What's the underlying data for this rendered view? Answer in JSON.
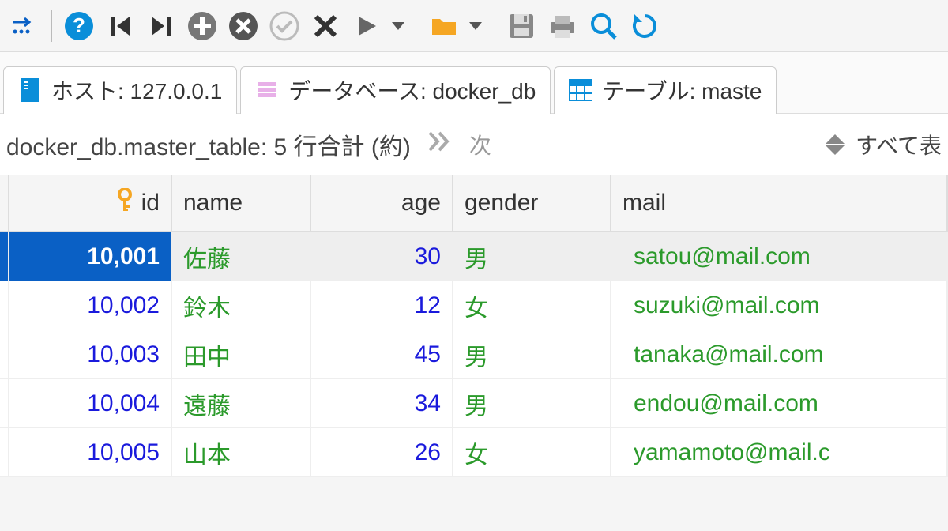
{
  "toolbar": {
    "icons": [
      "arrow-right-dotted",
      "separator",
      "help",
      "first",
      "last",
      "add",
      "remove",
      "confirm",
      "cancel",
      "play",
      "dropdown",
      "folder",
      "dropdown",
      "save",
      "print",
      "zoom",
      "refresh"
    ]
  },
  "tabs": {
    "host": {
      "label": "ホスト: 127.0.0.1"
    },
    "database": {
      "label": "データベース: docker_db"
    },
    "table": {
      "label": "テーブル: maste"
    }
  },
  "info": {
    "summary": "docker_db.master_table: 5 行合計 (約)",
    "next_label": "次",
    "showall_label": "すべて表"
  },
  "columns": [
    "id",
    "name",
    "age",
    "gender",
    "mail"
  ],
  "rows": [
    {
      "id": "10,001",
      "name": "佐藤",
      "age": "30",
      "gender": "男",
      "mail": "satou@mail.com",
      "selected": true
    },
    {
      "id": "10,002",
      "name": "鈴木",
      "age": "12",
      "gender": "女",
      "mail": "suzuki@mail.com",
      "selected": false
    },
    {
      "id": "10,003",
      "name": "田中",
      "age": "45",
      "gender": "男",
      "mail": "tanaka@mail.com",
      "selected": false
    },
    {
      "id": "10,004",
      "name": "遠藤",
      "age": "34",
      "gender": "男",
      "mail": "endou@mail.com",
      "selected": false
    },
    {
      "id": "10,005",
      "name": "山本",
      "age": "26",
      "gender": "女",
      "mail": "yamamoto@mail.c",
      "selected": false
    }
  ]
}
